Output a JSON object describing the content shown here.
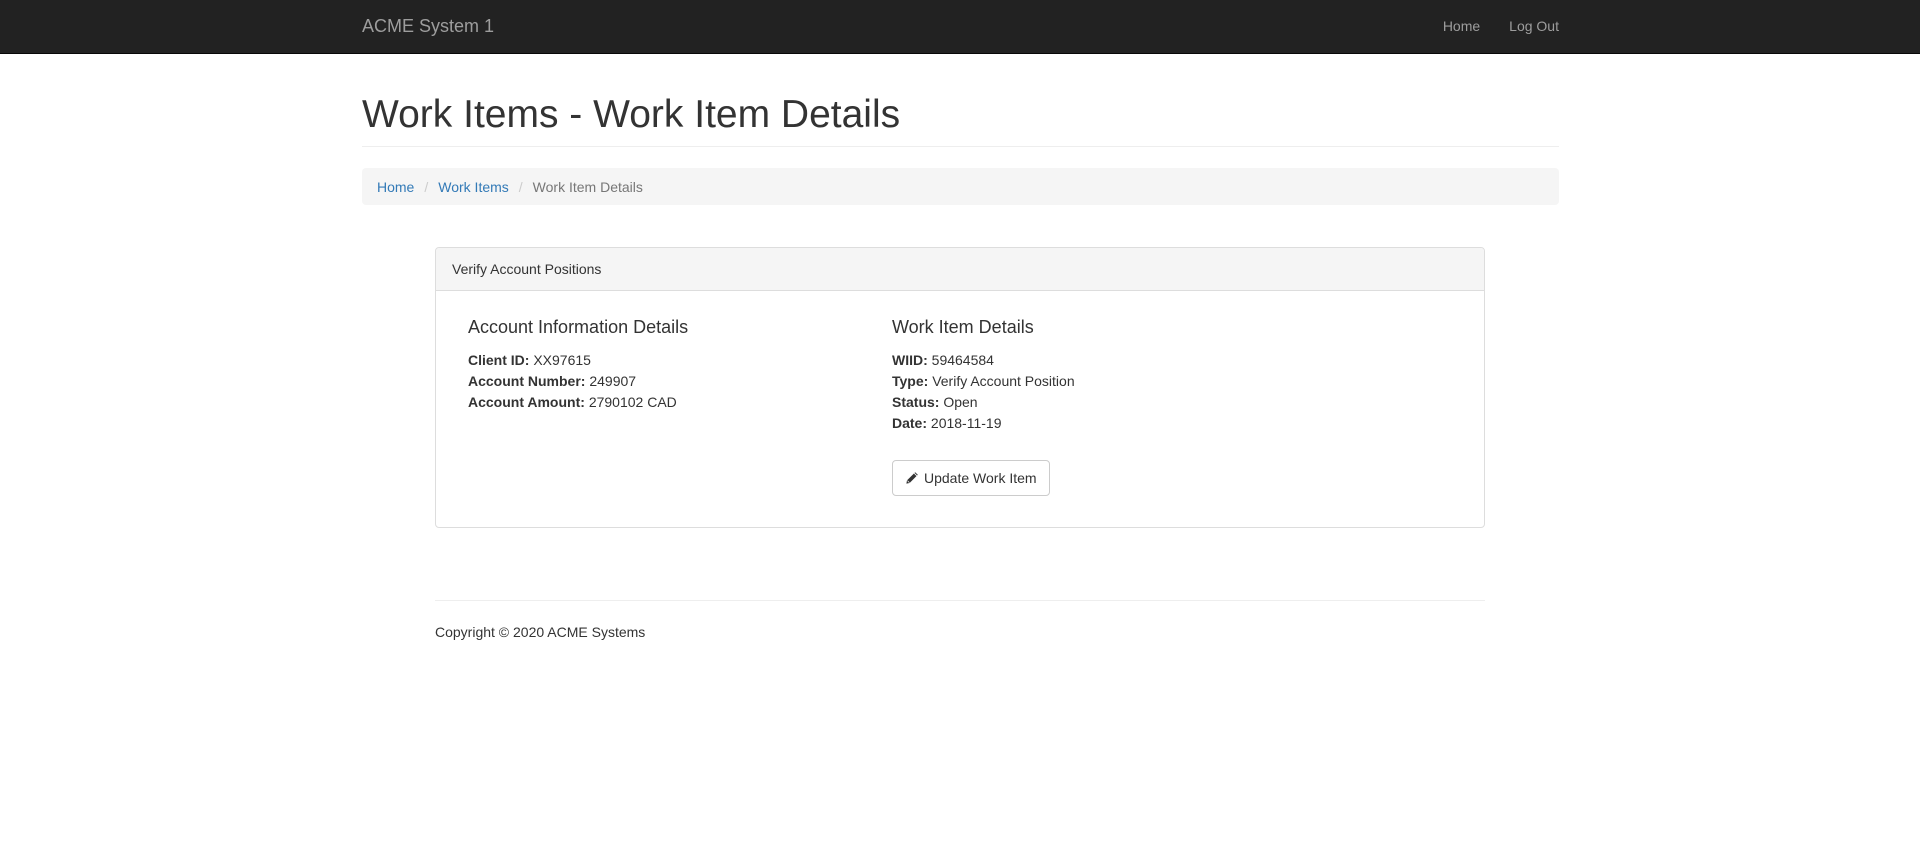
{
  "navbar": {
    "brand": "ACME System 1",
    "links": [
      {
        "label": "Home"
      },
      {
        "label": "Log Out"
      }
    ]
  },
  "page": {
    "title": "Work Items - Work Item Details"
  },
  "breadcrumb": {
    "items": [
      {
        "label": "Home"
      },
      {
        "label": "Work Items"
      },
      {
        "label": "Work Item Details"
      }
    ],
    "separator": "/"
  },
  "panel": {
    "heading": "Verify Account Positions",
    "account": {
      "title": "Account Information Details",
      "fields": [
        {
          "label": "Client ID:",
          "value": "XX97615"
        },
        {
          "label": "Account Number:",
          "value": "249907"
        },
        {
          "label": "Account Amount:",
          "value": "2790102 CAD"
        }
      ]
    },
    "work_item": {
      "title": "Work Item Details",
      "fields": [
        {
          "label": "WIID:",
          "value": "59464584"
        },
        {
          "label": "Type:",
          "value": "Verify Account Position"
        },
        {
          "label": "Status:",
          "value": "Open"
        },
        {
          "label": "Date:",
          "value": "2018-11-19"
        }
      ],
      "button_label": "Update Work Item",
      "button_icon": "pencil-icon"
    }
  },
  "footer": {
    "text": "Copyright © 2020 ACME Systems"
  },
  "colors": {
    "navbar_bg": "#222222",
    "nav_text": "#9d9d9d",
    "link": "#337ab7",
    "panel_heading_bg": "#f5f5f5"
  }
}
